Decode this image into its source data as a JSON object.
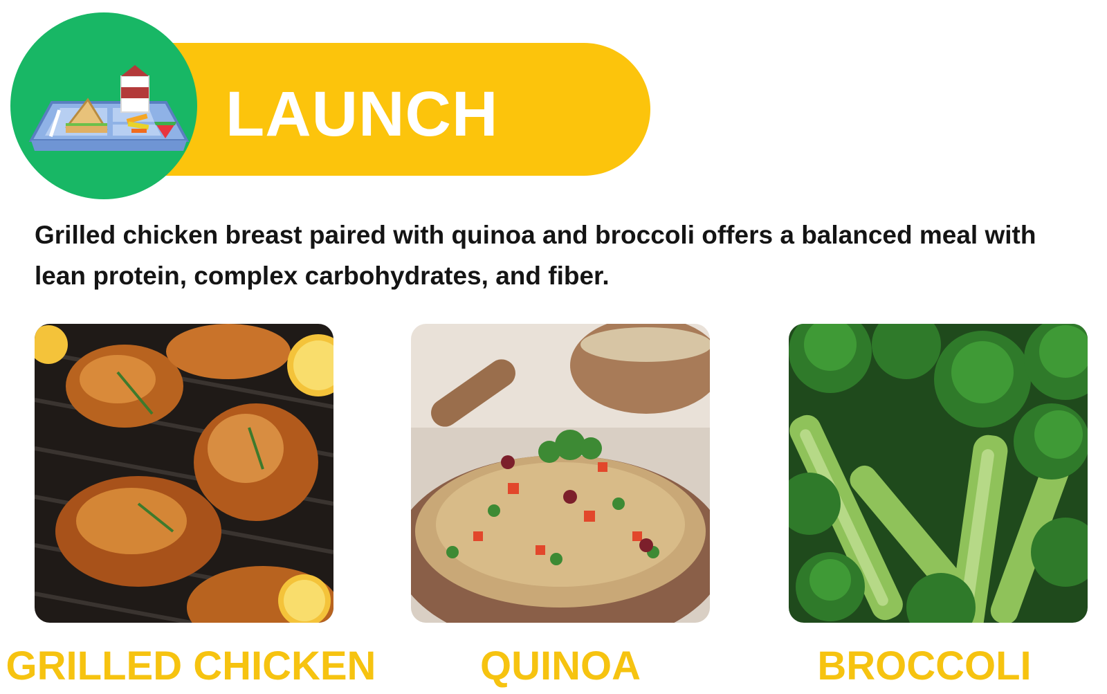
{
  "banner": {
    "title": "LAUNCH",
    "icon": "lunch-tray-icon"
  },
  "description": "Grilled chicken breast paired with quinoa and broccoli offers a balanced meal with lean protein, complex carbohydrates, and fiber.",
  "colors": {
    "banner_yellow": "#fcc40c",
    "badge_green": "#18b765",
    "caption_yellow": "#f6c310",
    "text_dark": "#141414"
  },
  "foods": [
    {
      "label": "GRILLED CHICKEN",
      "image": "grilled-chicken-photo"
    },
    {
      "label": "QUINOA",
      "image": "quinoa-bowl-photo"
    },
    {
      "label": "BROCCOLI",
      "image": "broccoli-photo"
    }
  ]
}
